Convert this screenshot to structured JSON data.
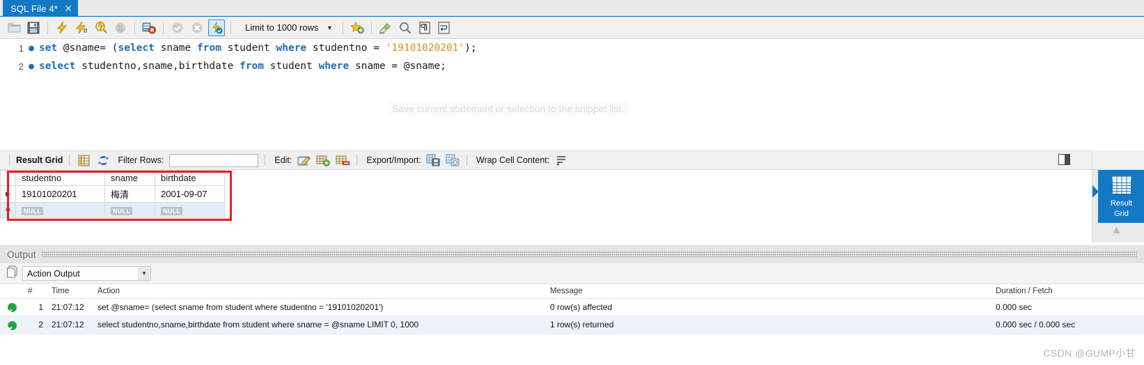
{
  "tab": {
    "label": "SQL File 4*",
    "close_icon": "close-icon"
  },
  "toolbar": {
    "icons": [
      {
        "name": "open-folder-icon"
      },
      {
        "name": "save-icon"
      },
      {
        "name": "execute-all-icon"
      },
      {
        "name": "execute-current-icon"
      },
      {
        "name": "explain-query-icon"
      },
      {
        "name": "stop-execution-icon"
      },
      {
        "name": "toggle-stop-on-error-icon"
      },
      {
        "name": "commit-icon"
      },
      {
        "name": "rollback-icon"
      },
      {
        "name": "auto-commit-icon"
      },
      {
        "name": "add-snippet-icon"
      },
      {
        "name": "beautify-sql-icon"
      },
      {
        "name": "find-icon"
      },
      {
        "name": "toggle-invisible-chars-icon"
      },
      {
        "name": "toggle-wrapping-icon"
      }
    ],
    "limit_label": "Limit to 1000 rows",
    "limit_caret": "▼"
  },
  "editor": {
    "lines": [
      {
        "number": "1",
        "bullet": "●",
        "tokens": [
          {
            "t": "kw",
            "v": "set "
          },
          {
            "t": "plain",
            "v": "@sname= ("
          },
          {
            "t": "kw",
            "v": "select "
          },
          {
            "t": "plain",
            "v": "sname "
          },
          {
            "t": "kw",
            "v": "from "
          },
          {
            "t": "plain",
            "v": "student "
          },
          {
            "t": "kw",
            "v": "where "
          },
          {
            "t": "plain",
            "v": "studentno = "
          },
          {
            "t": "str",
            "v": "'19101020201'"
          },
          {
            "t": "plain",
            "v": ");"
          }
        ]
      },
      {
        "number": "2",
        "bullet": "●",
        "tokens": [
          {
            "t": "kw",
            "v": "select "
          },
          {
            "t": "plain",
            "v": "studentno,sname,birthdate "
          },
          {
            "t": "kw",
            "v": "from "
          },
          {
            "t": "plain",
            "v": "student "
          },
          {
            "t": "kw",
            "v": "where "
          },
          {
            "t": "plain",
            "v": "sname = @sname;"
          }
        ]
      }
    ],
    "fading_tooltip": "Save current statement or selection to the snippet list."
  },
  "result_toolbar": {
    "title": "Result Grid",
    "grid_view_icon": "grid-view-icon",
    "refresh_icon": "refresh-icon",
    "filter_label": "Filter Rows:",
    "filter_value": "",
    "filter_placeholder": "",
    "edit_label": "Edit:",
    "edit_icons": [
      "edit-row-icon",
      "insert-row-icon",
      "delete-row-icon"
    ],
    "export_label": "Export/Import:",
    "export_icons": [
      "export-recordset-icon",
      "import-recordset-icon"
    ],
    "wrap_label": "Wrap Cell Content:",
    "wrap_icon": "wrap-cell-icon",
    "panel_toggle_icon": "toggle-sidebar-icon"
  },
  "result_grid": {
    "columns": [
      "studentno",
      "sname",
      "birthdate"
    ],
    "rows": [
      {
        "marker": "▶",
        "cells": [
          "19101020201",
          "梅清",
          "2001-09-07"
        ]
      }
    ],
    "null_row": {
      "marker": "✻",
      "cells": [
        "NULL",
        "NULL",
        "NULL"
      ]
    }
  },
  "right_rail": {
    "active_item": {
      "label_line1": "Result",
      "label_line2": "Grid",
      "icon": "table-grid-icon"
    },
    "collapse_chevron": "▲"
  },
  "output": {
    "panel_title": "Output",
    "selector_icon": "output-type-icon",
    "selector_value": "Action Output",
    "selector_caret": "▼",
    "columns": [
      "#",
      "Time",
      "Action",
      "Message",
      "Duration / Fetch"
    ],
    "rows": [
      {
        "status": "success",
        "num": "1",
        "time": "21:07:12",
        "action": "set @sname= (select sname from student where studentno = '19101020201')",
        "message": "0 row(s) affected",
        "duration": "0.000 sec"
      },
      {
        "status": "success",
        "num": "2",
        "time": "21:07:12",
        "action": "select studentno,sname,birthdate from student where sname = @sname LIMIT 0, 1000",
        "message": "1 row(s) returned",
        "duration": "0.000 sec / 0.000 sec"
      }
    ]
  },
  "watermark": {
    "text": "CSDN @GUMP小甘"
  },
  "colors": {
    "accent_blue": "#1479c4",
    "keyword_blue": "#1e6bb8",
    "string_orange": "#d98a1b",
    "highlight_red": "#ee1c1c",
    "success_green": "#21a645"
  }
}
